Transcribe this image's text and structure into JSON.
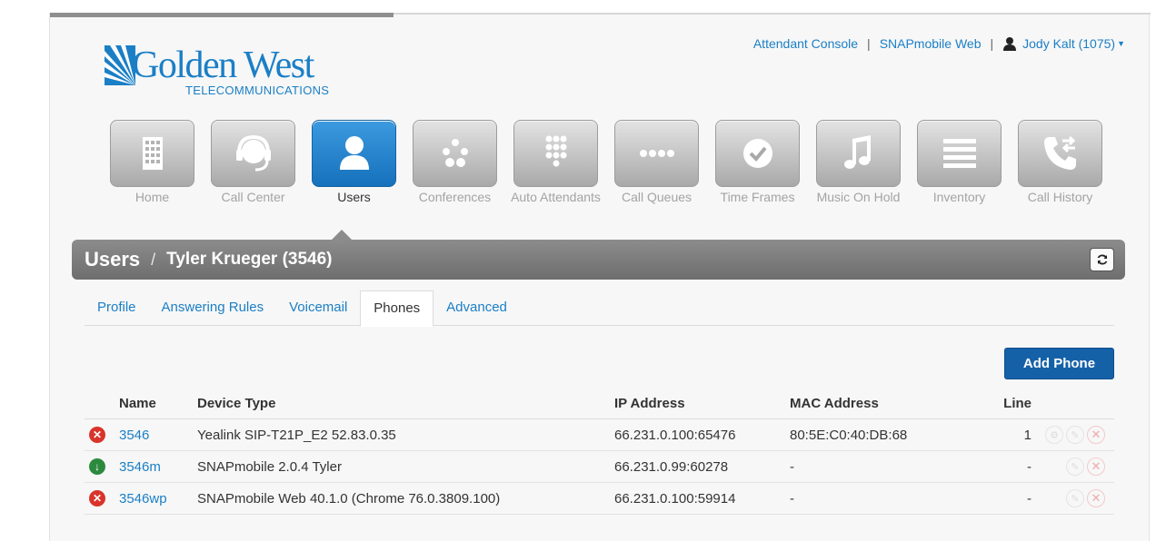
{
  "logo": {
    "name": "Golden West",
    "subtitle": "TELECOMMUNICATIONS"
  },
  "toplinks": {
    "attendant": "Attendant Console",
    "sep": "|",
    "snap": "SNAPmobile Web",
    "user": "Jody Kalt (1075)"
  },
  "nav": [
    {
      "label": "Home",
      "icon": "building-icon"
    },
    {
      "label": "Call Center",
      "icon": "headset-icon"
    },
    {
      "label": "Users",
      "icon": "user-icon",
      "active": true
    },
    {
      "label": "Conferences",
      "icon": "conference-icon"
    },
    {
      "label": "Auto Attendants",
      "icon": "keypad-icon"
    },
    {
      "label": "Call Queues",
      "icon": "queue-icon"
    },
    {
      "label": "Time Frames",
      "icon": "clock-icon"
    },
    {
      "label": "Music On Hold",
      "icon": "music-note-icon"
    },
    {
      "label": "Inventory",
      "icon": "list-icon"
    },
    {
      "label": "Call History",
      "icon": "phone-history-icon"
    }
  ],
  "breadcrumb": {
    "section": "Users",
    "sep": "/",
    "current": "Tyler Krueger (3546)"
  },
  "tabs": [
    "Profile",
    "Answering Rules",
    "Voicemail",
    "Phones",
    "Advanced"
  ],
  "active_tab": "Phones",
  "add_button": "Add Phone",
  "table": {
    "headers": {
      "name": "Name",
      "device": "Device Type",
      "ip": "IP Address",
      "mac": "MAC Address",
      "line": "Line"
    },
    "rows": [
      {
        "status": "offline",
        "name": "3546",
        "device": "Yealink SIP-T21P_E2 52.83.0.35",
        "ip": "66.231.0.100:65476",
        "mac": "80:5E:C0:40:DB:68",
        "line": "1"
      },
      {
        "status": "online",
        "name": "3546m",
        "device": "SNAPmobile 2.0.4 Tyler",
        "ip": "66.231.0.99:60278",
        "mac": "-",
        "line": "-"
      },
      {
        "status": "offline",
        "name": "3546wp",
        "device": "SNAPmobile Web 40.1.0 (Chrome 76.0.3809.100)",
        "ip": "66.231.0.100:59914",
        "mac": "-",
        "line": "-"
      }
    ]
  },
  "colors": {
    "brand": "#1b7fc6",
    "button": "#1561a8",
    "offline": "#d9342b",
    "online": "#2c8a3e"
  }
}
